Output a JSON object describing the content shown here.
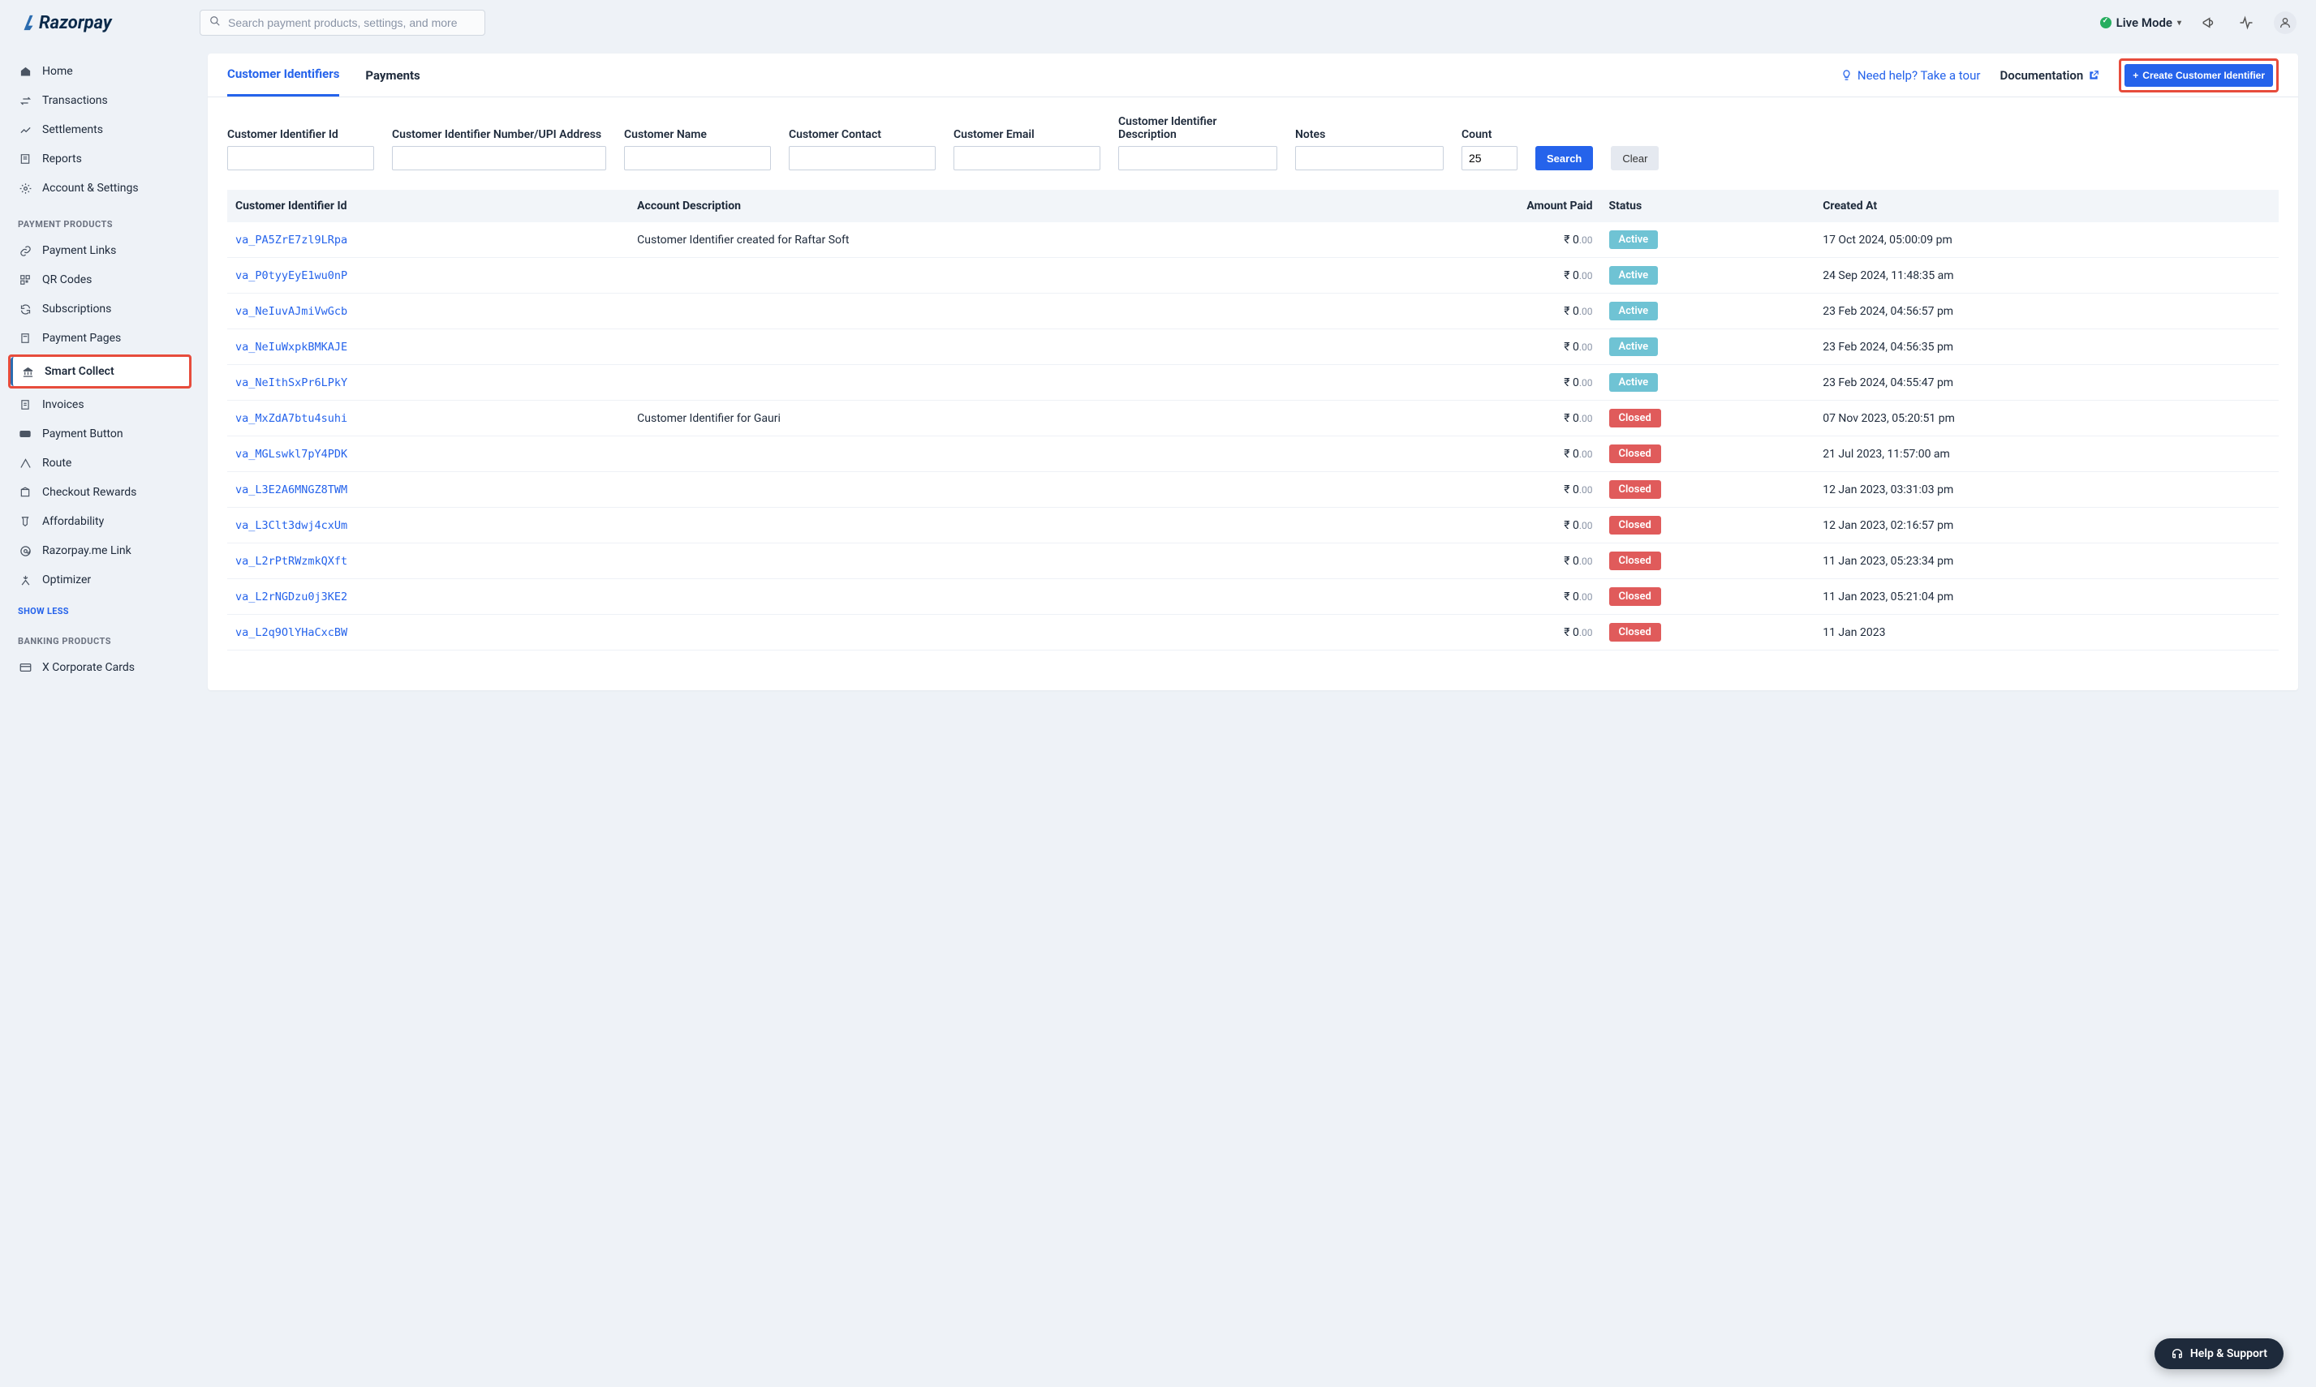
{
  "brand": "Razorpay",
  "search": {
    "placeholder": "Search payment products, settings, and more"
  },
  "topbar": {
    "mode_label": "Live Mode"
  },
  "sidebar": {
    "items": [
      {
        "label": "Home"
      },
      {
        "label": "Transactions"
      },
      {
        "label": "Settlements"
      },
      {
        "label": "Reports"
      },
      {
        "label": "Account & Settings"
      }
    ],
    "section1": "PAYMENT PRODUCTS",
    "products": [
      {
        "label": "Payment Links"
      },
      {
        "label": "QR Codes"
      },
      {
        "label": "Subscriptions"
      },
      {
        "label": "Payment Pages"
      },
      {
        "label": "Smart Collect",
        "active": true,
        "highlight": true
      },
      {
        "label": "Invoices"
      },
      {
        "label": "Payment Button"
      },
      {
        "label": "Route"
      },
      {
        "label": "Checkout Rewards"
      },
      {
        "label": "Affordability"
      },
      {
        "label": "Razorpay.me Link"
      },
      {
        "label": "Optimizer"
      }
    ],
    "show_less": "SHOW LESS",
    "section2": "BANKING PRODUCTS",
    "banking": [
      {
        "label": "X Corporate Cards"
      }
    ]
  },
  "tabs": {
    "items": [
      "Customer Identifiers",
      "Payments"
    ],
    "need_help": "Need help? Take a tour",
    "documentation": "Documentation",
    "create_btn": "Create Customer Identifier"
  },
  "filters": {
    "labels": {
      "id": "Customer Identifier Id",
      "upi": "Customer Identifier Number/UPI Address",
      "name": "Customer Name",
      "contact": "Customer Contact",
      "email": "Customer Email",
      "desc": "Customer Identifier Description",
      "notes": "Notes",
      "count": "Count"
    },
    "count_value": "25",
    "search": "Search",
    "clear": "Clear"
  },
  "table": {
    "headers": [
      "Customer Identifier Id",
      "Account Description",
      "Amount Paid",
      "Status",
      "Created At"
    ],
    "rows": [
      {
        "id": "va_PA5ZrE7zl9LRpa",
        "desc": "Customer Identifier created for Raftar Soft",
        "amt_int": "₹ 0",
        "amt_dec": ".00",
        "status": "Active",
        "created": "17 Oct 2024, 05:00:09 pm"
      },
      {
        "id": "va_P0tyyEyE1wu0nP",
        "desc": "",
        "amt_int": "₹ 0",
        "amt_dec": ".00",
        "status": "Active",
        "created": "24 Sep 2024, 11:48:35 am"
      },
      {
        "id": "va_NeIuvAJmiVwGcb",
        "desc": "",
        "amt_int": "₹ 0",
        "amt_dec": ".00",
        "status": "Active",
        "created": "23 Feb 2024, 04:56:57 pm"
      },
      {
        "id": "va_NeIuWxpkBMKAJE",
        "desc": "",
        "amt_int": "₹ 0",
        "amt_dec": ".00",
        "status": "Active",
        "created": "23 Feb 2024, 04:56:35 pm"
      },
      {
        "id": "va_NeIthSxPr6LPkY",
        "desc": "",
        "amt_int": "₹ 0",
        "amt_dec": ".00",
        "status": "Active",
        "created": "23 Feb 2024, 04:55:47 pm"
      },
      {
        "id": "va_MxZdA7btu4suhi",
        "desc": "Customer Identifier for Gauri",
        "amt_int": "₹ 0",
        "amt_dec": ".00",
        "status": "Closed",
        "created": "07 Nov 2023, 05:20:51 pm"
      },
      {
        "id": "va_MGLswkl7pY4PDK",
        "desc": "",
        "amt_int": "₹ 0",
        "amt_dec": ".00",
        "status": "Closed",
        "created": "21 Jul 2023, 11:57:00 am"
      },
      {
        "id": "va_L3E2A6MNGZ8TWM",
        "desc": "",
        "amt_int": "₹ 0",
        "amt_dec": ".00",
        "status": "Closed",
        "created": "12 Jan 2023, 03:31:03 pm"
      },
      {
        "id": "va_L3Clt3dwj4cxUm",
        "desc": "",
        "amt_int": "₹ 0",
        "amt_dec": ".00",
        "status": "Closed",
        "created": "12 Jan 2023, 02:16:57 pm"
      },
      {
        "id": "va_L2rPtRWzmkQXft",
        "desc": "",
        "amt_int": "₹ 0",
        "amt_dec": ".00",
        "status": "Closed",
        "created": "11 Jan 2023, 05:23:34 pm"
      },
      {
        "id": "va_L2rNGDzu0j3KE2",
        "desc": "",
        "amt_int": "₹ 0",
        "amt_dec": ".00",
        "status": "Closed",
        "created": "11 Jan 2023, 05:21:04 pm"
      },
      {
        "id": "va_L2q9OlYHaCxcBW",
        "desc": "",
        "amt_int": "₹ 0",
        "amt_dec": ".00",
        "status": "Closed",
        "created": "11 Jan 2023"
      }
    ]
  },
  "help_float": "Help & Support"
}
